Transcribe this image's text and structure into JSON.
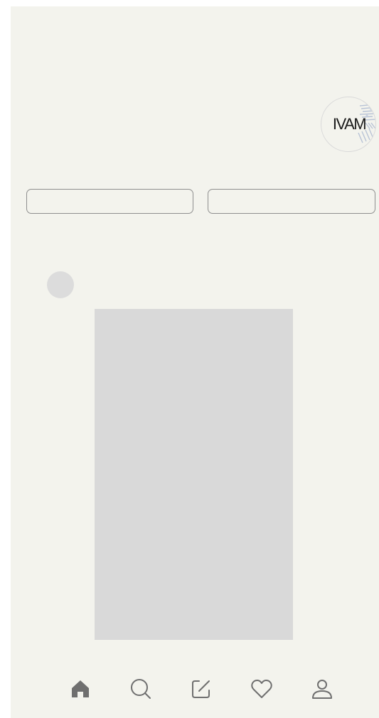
{
  "profile": {
    "logo_text": "IVAM",
    "logo_icon": "ivam-logo-icon"
  },
  "actions": {
    "left_button_label": "",
    "right_button_label": ""
  },
  "post": {
    "avatar_icon": "user-avatar-placeholder",
    "image_icon": "image-placeholder"
  },
  "nav": {
    "items": [
      {
        "icon": "home-icon",
        "active": true
      },
      {
        "icon": "search-icon",
        "active": false
      },
      {
        "icon": "compose-icon",
        "active": false
      },
      {
        "icon": "heart-icon",
        "active": false
      },
      {
        "icon": "profile-icon",
        "active": false
      }
    ]
  },
  "colors": {
    "background": "#f3f3ed",
    "placeholder": "#d9d9d9",
    "icon": "#6f6f6f",
    "border": "#8e8e8e"
  }
}
